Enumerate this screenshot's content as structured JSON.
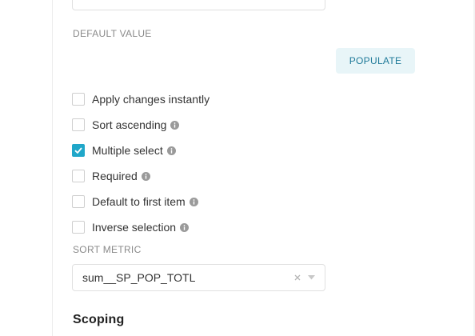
{
  "top_field": {
    "value": "None"
  },
  "default_value": {
    "label": "DEFAULT VALUE",
    "populate_label": "POPULATE"
  },
  "options": [
    {
      "label": "Apply changes instantly",
      "checked": false,
      "info": false
    },
    {
      "label": "Sort ascending",
      "checked": false,
      "info": true
    },
    {
      "label": "Multiple select",
      "checked": true,
      "info": true
    },
    {
      "label": "Required",
      "checked": false,
      "info": true
    },
    {
      "label": "Default to first item",
      "checked": false,
      "info": true
    },
    {
      "label": "Inverse selection",
      "checked": false,
      "info": true
    }
  ],
  "sort_metric": {
    "label": "SORT METRIC",
    "value": "sum__SP_POP_TOTL"
  },
  "scoping": {
    "title": "Scoping"
  },
  "colors": {
    "accent": "#20a7c9",
    "populate_bg": "#e8f5f8",
    "populate_text": "#1f7a99"
  }
}
